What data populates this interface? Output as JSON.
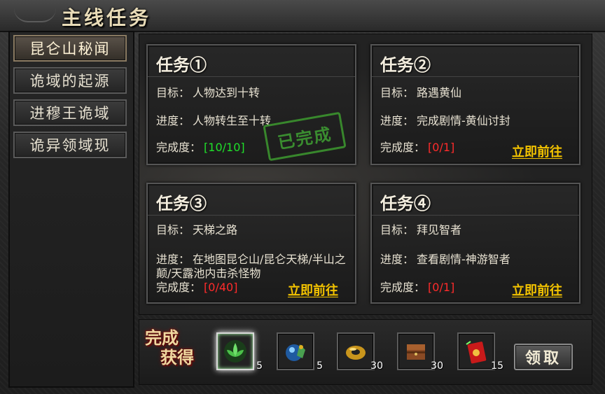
{
  "window": {
    "title": "主线任务"
  },
  "sidebar": {
    "tabs": [
      {
        "label": "昆仑山秘闻",
        "active": true
      },
      {
        "label": "诡域的起源",
        "active": false
      },
      {
        "label": "进穆王诡域",
        "active": false
      },
      {
        "label": "诡异领域现",
        "active": false
      }
    ]
  },
  "labels": {
    "goal": "目标：",
    "progress": "进度：",
    "completion": "完成度："
  },
  "tasks": [
    {
      "title": "任务①",
      "goal": "人物达到十转",
      "progress": "人物转生至十转",
      "completion": "[10/10]",
      "status": "done",
      "stamp": "已完成"
    },
    {
      "title": "任务②",
      "goal": "路遇黄仙",
      "progress": "完成剧情-黄仙讨封",
      "completion": "[0/1]",
      "status": "todo",
      "action": "立即前往"
    },
    {
      "title": "任务③",
      "goal": "天梯之路",
      "progress": "在地图昆仑山/昆仑天梯/半山之颠/天露池内击杀怪物",
      "completion": "[0/40]",
      "status": "todo",
      "action": "立即前往"
    },
    {
      "title": "任务④",
      "goal": "拜见智者",
      "progress": "查看剧情-神游智者",
      "completion": "[0/1]",
      "status": "todo",
      "action": "立即前往"
    }
  ],
  "rewards": {
    "title_line1": "完成",
    "title_line2": "获得",
    "items": [
      {
        "icon": "green-lotus-icon",
        "qty": "5"
      },
      {
        "icon": "orb-potion-icon",
        "qty": "5"
      },
      {
        "icon": "gold-ring-icon",
        "qty": "30"
      },
      {
        "icon": "wood-chest-icon",
        "qty": "30"
      },
      {
        "icon": "red-envelope-icon",
        "qty": "15"
      }
    ],
    "claim_label": "领取"
  },
  "colors": {
    "done": "#1fe02a",
    "todo": "#ff2b2b",
    "link": "#f2c200"
  }
}
